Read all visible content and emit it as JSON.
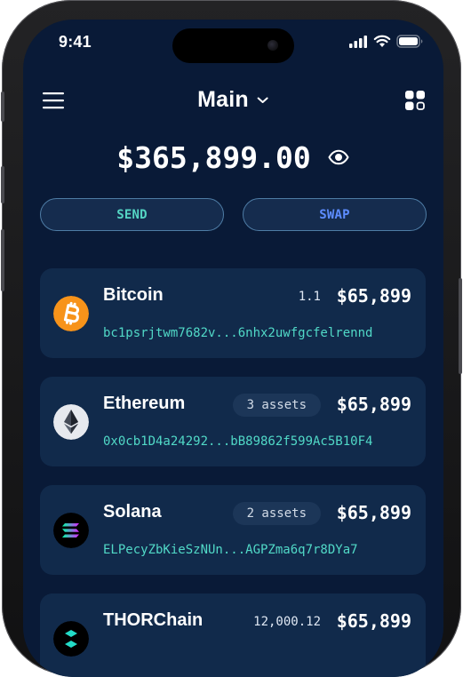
{
  "status": {
    "time": "9:41"
  },
  "header": {
    "wallet_name": "Main"
  },
  "portfolio": {
    "balance": "$365,899.00"
  },
  "actions": {
    "send_label": "SEND",
    "swap_label": "SWAP"
  },
  "assets": [
    {
      "name": "Bitcoin",
      "meta": "1.1",
      "value": "$65,899",
      "address": "bc1psrjtwm7682v...6nhx2uwfgcfelrennd"
    },
    {
      "name": "Ethereum",
      "meta": "3 assets",
      "value": "$65,899",
      "address": "0x0cb1D4a24292...bB89862f599Ac5B10F4"
    },
    {
      "name": "Solana",
      "meta": "2 assets",
      "value": "$65,899",
      "address": "ELPecyZbKieSzNUn...AGPZma6q7r8DYa7"
    },
    {
      "name": "THORChain",
      "meta": "12,000.12",
      "value": "$65,899",
      "address": ""
    }
  ],
  "icons": {
    "menu": "menu-icon",
    "chevron": "chevron-down-icon",
    "grid": "grid-icon",
    "eye": "eye-icon",
    "signal": "signal-icon",
    "wifi": "wifi-icon",
    "battery": "battery-icon"
  },
  "colors": {
    "background": "#091a37",
    "card": "#112a4b",
    "send": "#55d6c4",
    "swap": "#5d8dff",
    "address": "#51d9c7"
  }
}
